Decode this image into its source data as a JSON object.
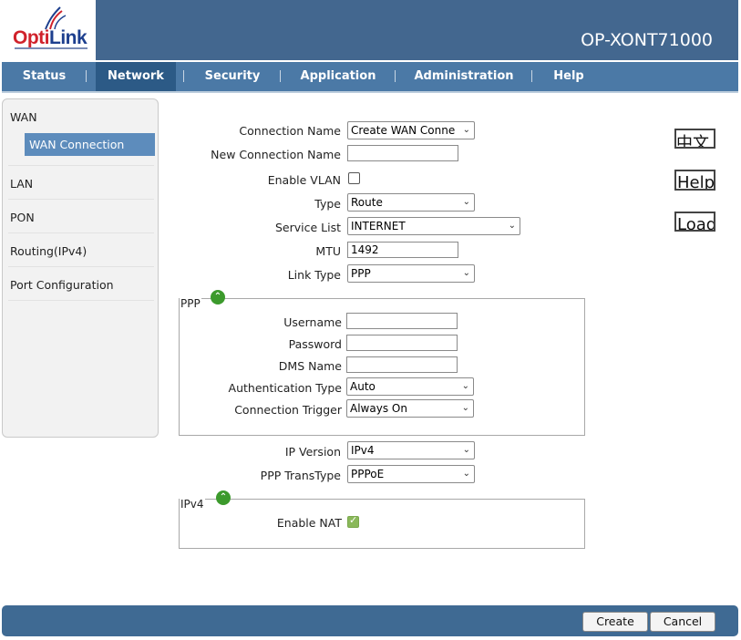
{
  "header": {
    "logo_text_red": "Opti",
    "logo_text_blue": "Link",
    "model": "OP-XONT71000"
  },
  "nav": {
    "items": [
      {
        "label": "Status"
      },
      {
        "label": "Network",
        "active": true
      },
      {
        "label": "Security"
      },
      {
        "label": "Application"
      },
      {
        "label": "Administration"
      },
      {
        "label": "Help"
      }
    ]
  },
  "sidebar": {
    "wan": "WAN",
    "wan_connection": "WAN Connection",
    "lan": "LAN",
    "pon": "PON",
    "routing": "Routing(IPv4)",
    "port_config": "Port Configuration"
  },
  "form": {
    "connection_name": {
      "label": "Connection Name",
      "value": "Create WAN Conne"
    },
    "new_connection_name": {
      "label": "New Connection Name",
      "value": ""
    },
    "enable_vlan": {
      "label": "Enable VLAN",
      "checked": false
    },
    "type": {
      "label": "Type",
      "value": "Route"
    },
    "service_list": {
      "label": "Service List",
      "value": "INTERNET"
    },
    "mtu": {
      "label": "MTU",
      "value": "1492"
    },
    "link_type": {
      "label": "Link Type",
      "value": "PPP"
    },
    "ppp_group": {
      "title": "PPP",
      "username": {
        "label": "Username",
        "value": ""
      },
      "password": {
        "label": "Password",
        "value": ""
      },
      "dms_name": {
        "label": "DMS Name",
        "value": ""
      },
      "auth_type": {
        "label": "Authentication Type",
        "value": "Auto"
      },
      "conn_trigger": {
        "label": "Connection Trigger",
        "value": "Always On"
      }
    },
    "ip_version": {
      "label": "IP Version",
      "value": "IPv4"
    },
    "ppp_transtype": {
      "label": "PPP TransType",
      "value": "PPPoE"
    },
    "ipv4_group": {
      "title": "IPv4",
      "enable_nat": {
        "label": "Enable NAT",
        "checked": true
      }
    }
  },
  "side_buttons": {
    "lang": "中文",
    "help": "Help",
    "load": "Load"
  },
  "footer": {
    "create": "Create",
    "cancel": "Cancel"
  },
  "colors": {
    "header": "#43678f",
    "nav": "#4b79a6",
    "nav_active": "#2c5a86",
    "sidebar_active": "#5d8cbc",
    "footer": "#3f6a93",
    "collapse_icon": "#3c9a2c"
  }
}
